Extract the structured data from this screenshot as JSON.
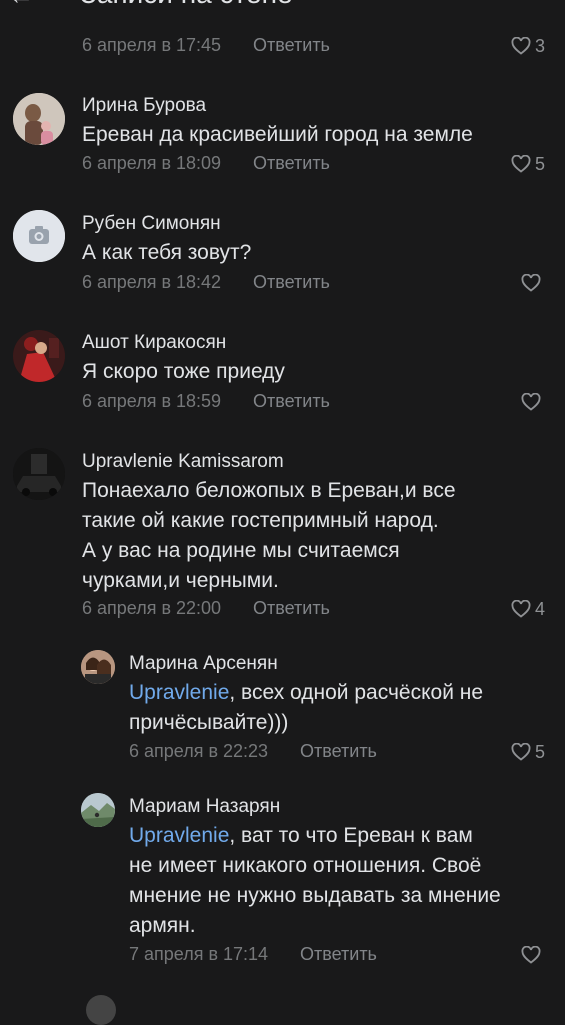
{
  "header": {
    "title": "Записи на стене",
    "back_glyph": "←"
  },
  "reply_label": "Ответить",
  "top_meta": {
    "date": "6 апреля в 17:45",
    "likes": "3"
  },
  "comments": [
    {
      "author": "Ирина Бурова",
      "text": "Ереван да красивейший  город на земле",
      "date": "6 апреля в 18:09",
      "likes": "5",
      "avatar_icon": "person-photo"
    },
    {
      "author": "Рубен Симонян",
      "text": "А как тебя зовут?",
      "date": "6 апреля в 18:42",
      "likes": "",
      "avatar_icon": "camera-icon"
    },
    {
      "author": "Ашот Киракосян",
      "text": "Я скоро тоже приеду",
      "date": "6 апреля в 18:59",
      "likes": "",
      "avatar_icon": "red-photo"
    },
    {
      "author": "Upravlenie Kamissarom",
      "lines": [
        "Понаехало беложопых в Ереван,и все",
        "такие ой какие гостепримный народ.",
        "А у вас на родине мы считаемся",
        "чурками,и черными."
      ],
      "date": "6 апреля в 22:00",
      "likes": "4",
      "avatar_icon": "car-photo"
    }
  ],
  "replies": [
    {
      "author": "Марина Арсенян",
      "mention": "Upravlenie",
      "first_rest": ", всех одной расчёской не",
      "lines": [
        "причёсывайте)))"
      ],
      "date": "6 апреля в 22:23",
      "likes": "5"
    },
    {
      "author": "Мариам Назарян",
      "mention": "Upravlenie",
      "first_rest": ", ват то что Ереван к вам",
      "lines": [
        "не имеет никакого отношения. Своё",
        "мнение не нужно выдавать за мнение",
        "армян."
      ],
      "date": "7 апреля в 17:14",
      "likes": ""
    }
  ],
  "colors": {
    "background": "#19191a",
    "text": "#e1e3e6",
    "secondary": "#76787a",
    "mention": "#71aaeb"
  }
}
